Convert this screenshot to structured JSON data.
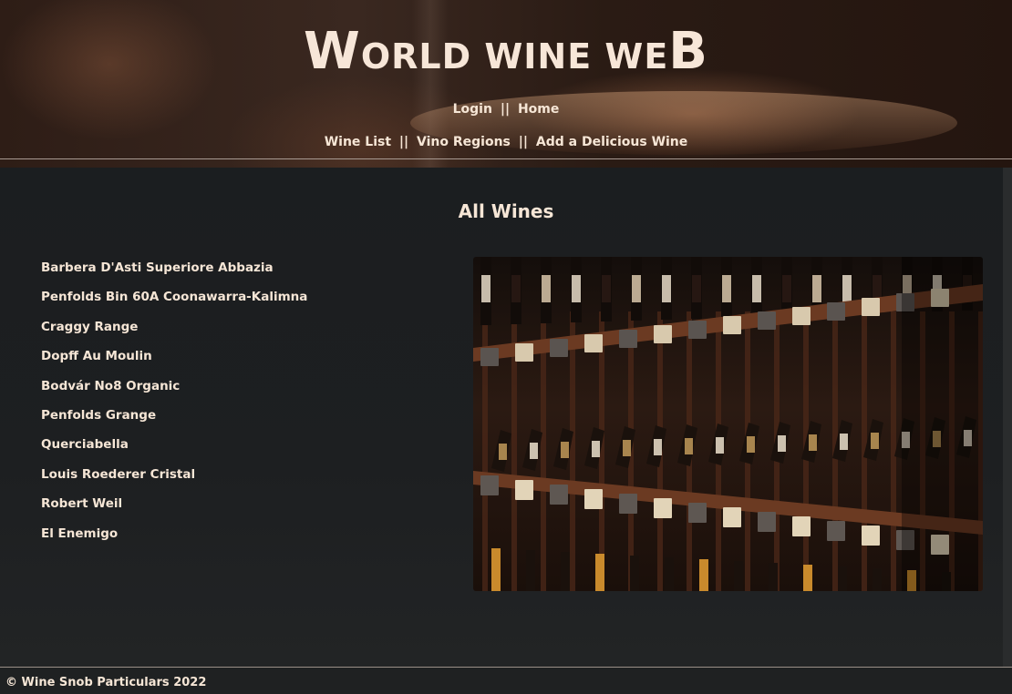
{
  "header": {
    "title_first": "W",
    "title_mid": "ORLD WINE WE",
    "title_last": "B",
    "nav_top": {
      "login": "Login",
      "separator": "||",
      "home": "Home"
    },
    "nav_main": {
      "wine_list": "Wine List",
      "vino_regions": "Vino Regions",
      "add_wine": "Add a Delicious Wine",
      "separator": "||"
    }
  },
  "main": {
    "heading": "All Wines",
    "wines": [
      "Barbera D'Asti Superiore Abbazia",
      "Penfolds Bin 60A Coonawarra-Kalimna",
      "Craggy Range",
      "Dopff Au Moulin",
      "Bodvár No8 Organic",
      "Penfolds Grange",
      "Querciabella",
      "Louis Roederer Cristal",
      "Robert Weil",
      "El Enemigo"
    ]
  },
  "footer": {
    "copyright": "© Wine Snob Particulars 2022"
  },
  "colors": {
    "text": "#f6e6d6",
    "background": "#1c1e1f",
    "header_tint": "#3a2820",
    "shelf_wood": "#6b3a22"
  }
}
